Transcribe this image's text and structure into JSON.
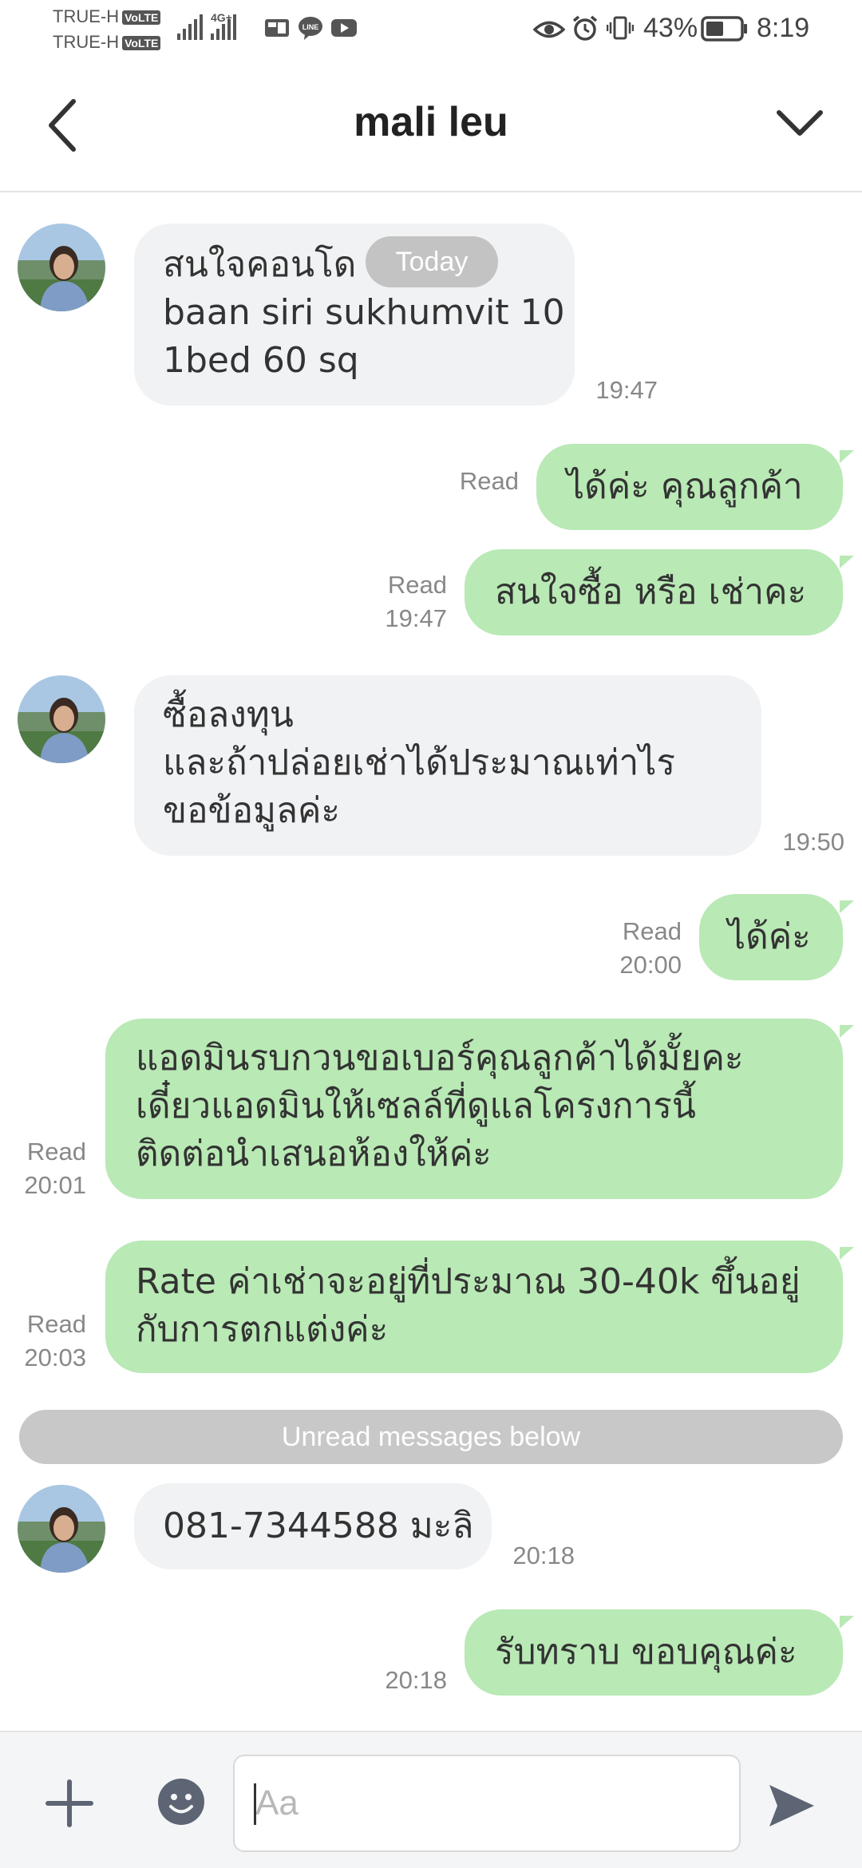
{
  "status_bar": {
    "carrier_1": "TRUE-H",
    "carrier_2": "TRUE-H",
    "volte_badge": "VoLTE",
    "network_badge": "4G+",
    "battery_percent": "43%",
    "time": "8:19",
    "icons": [
      "signal-icon",
      "signal-4g-icon",
      "data-saver-icon",
      "line-app-icon",
      "youtube-icon",
      "eye-icon",
      "alarm-icon",
      "vibrate-icon",
      "battery-icon"
    ]
  },
  "header": {
    "title": "mali leu",
    "icons": [
      "back-arrow-icon",
      "chevron-down-icon"
    ]
  },
  "date_separator": "Today",
  "unread_separator": "Unread messages below",
  "messages": [
    {
      "direction": "in",
      "lines": [
        "สนใจคอนโด",
        "baan siri sukhumvit 10",
        "1bed 60 sq"
      ],
      "time": "19:47"
    },
    {
      "direction": "out",
      "lines": [
        "ได้ค่ะ คุณลูกค้า"
      ],
      "status": "Read",
      "time": ""
    },
    {
      "direction": "out",
      "lines": [
        "สนใจซื้อ หรือ เช่าคะ"
      ],
      "status": "Read",
      "time": "19:47"
    },
    {
      "direction": "in",
      "lines": [
        "ซื้อลงทุน",
        "และถ้าปล่อยเช่าได้ประมาณเท่าไร",
        "ขอข้อมูลค่ะ"
      ],
      "time": "19:50"
    },
    {
      "direction": "out",
      "lines": [
        "ได้ค่ะ"
      ],
      "status": "Read",
      "time": "20:00"
    },
    {
      "direction": "out",
      "lines": [
        "แอดมินรบกวนขอเบอร์คุณลูกค้าได้มั้ยคะ",
        "เดี๋ยวแอดมินให้เซลล์ที่ดูแลโครงการนี้",
        "ติดต่อนำเสนอห้องให้ค่ะ"
      ],
      "status": "Read",
      "time": "20:01"
    },
    {
      "direction": "out",
      "lines": [
        "Rate ค่าเช่าจะอยู่ที่ประมาณ 30-40k ขึ้นอยู่",
        "กับการตกแต่งค่ะ"
      ],
      "status": "Read",
      "time": "20:03"
    },
    {
      "direction": "in",
      "lines": [
        "081-7344588 มะลิ"
      ],
      "time": "20:18"
    },
    {
      "direction": "out",
      "lines": [
        "รับทราบ ขอบคุณค่ะ"
      ],
      "status": "",
      "time": "20:18"
    }
  ],
  "input_bar": {
    "placeholder": "Aa",
    "value": "",
    "icons": [
      "plus-icon",
      "emoji-icon",
      "send-icon"
    ]
  },
  "colors": {
    "outgoing_bubble": "#b9e9b5",
    "incoming_bubble": "#f1f2f4",
    "separator_pill": "#c3c3c3",
    "icon_gray": "#5d6474"
  }
}
